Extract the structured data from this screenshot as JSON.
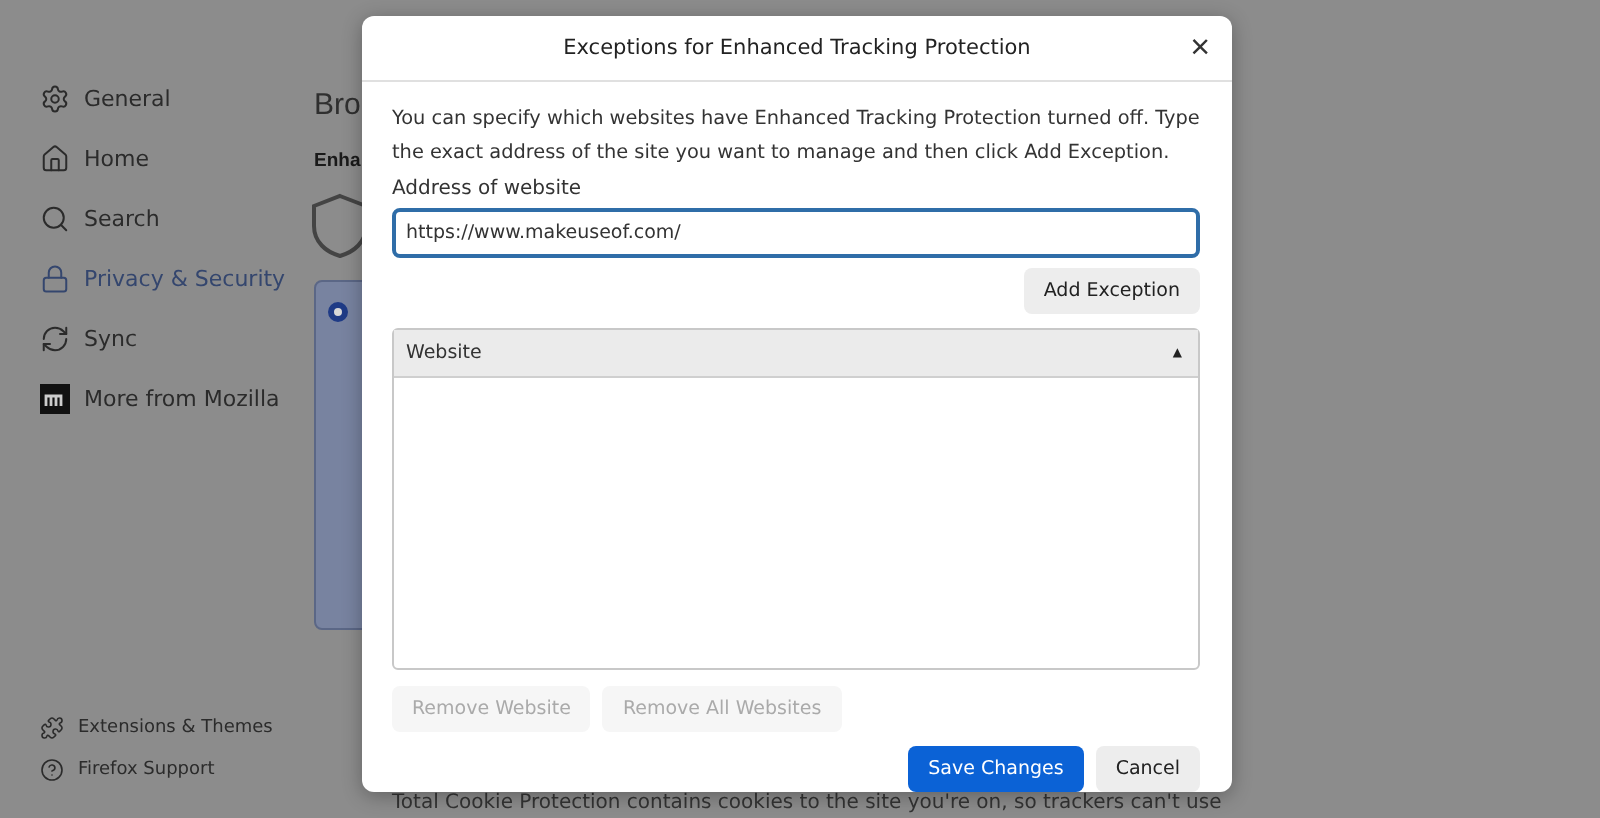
{
  "sidebar": {
    "items": [
      {
        "label": "General",
        "selected": false
      },
      {
        "label": "Home",
        "selected": false
      },
      {
        "label": "Search",
        "selected": false
      },
      {
        "label": "Privacy & Security",
        "selected": true
      },
      {
        "label": "Sync",
        "selected": false
      },
      {
        "label": "More from Mozilla",
        "selected": false
      }
    ],
    "footer": [
      {
        "label": "Extensions & Themes"
      },
      {
        "label": "Firefox Support"
      }
    ]
  },
  "page": {
    "heading": "Bro",
    "subheading": "Enha",
    "radio_selected": true,
    "footnote": "Total Cookie Protection contains cookies to the site you're on, so trackers can't use"
  },
  "dialog": {
    "title": "Exceptions for Enhanced Tracking Protection",
    "close": "×",
    "description": "You can specify which websites have Enhanced Tracking Protection turned off. Type the exact address of the site you want to manage and then click Add Exception.",
    "address_label": "Address of website",
    "address_value": "https://www.makeuseof.com/",
    "add_button": "Add Exception",
    "table": {
      "columns": [
        {
          "label": "Website",
          "sort": "▲"
        }
      ]
    },
    "remove_buttons": [
      {
        "label": "Remove Website",
        "disabled": true
      },
      {
        "label": "Remove All Websites",
        "disabled": true
      }
    ],
    "buttons": [
      {
        "label": "Save Changes",
        "kind": "primary"
      },
      {
        "label": "Cancel",
        "kind": "secondary"
      }
    ]
  }
}
